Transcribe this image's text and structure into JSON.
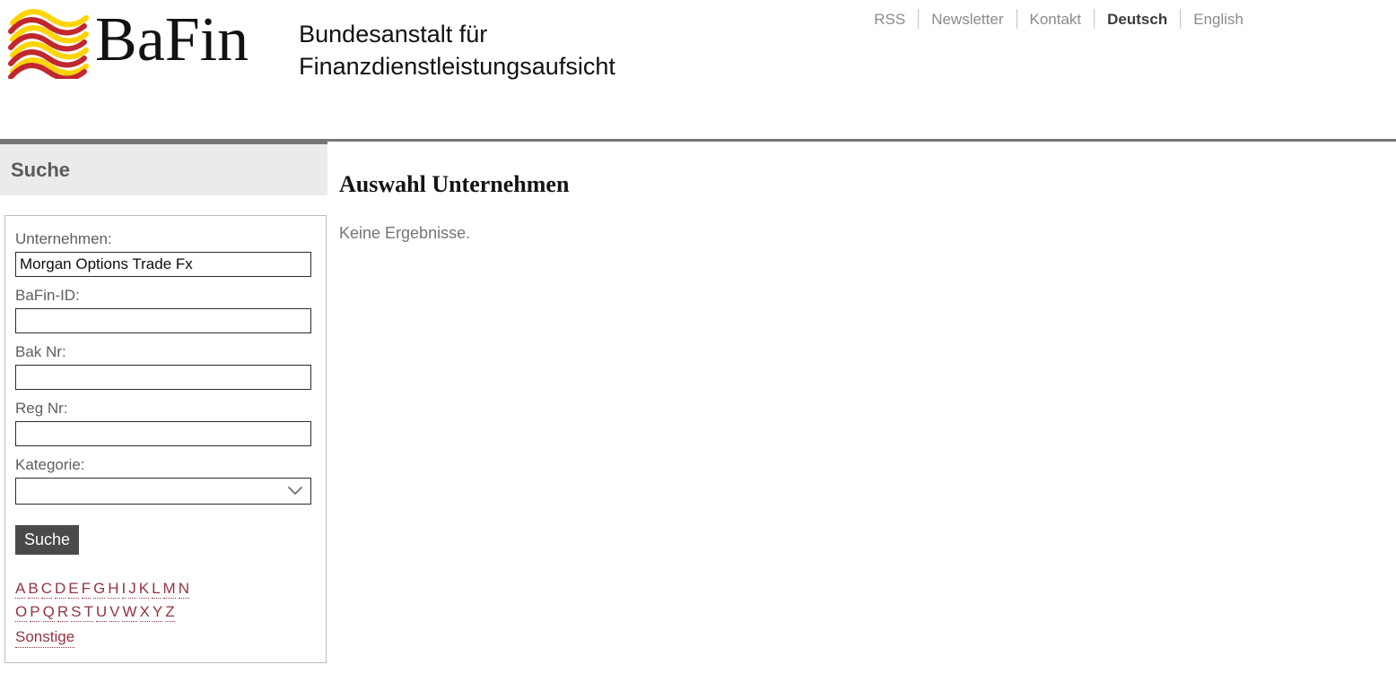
{
  "header": {
    "logo_word": "BaFin",
    "logo_subtitle": "Bundesanstalt für\nFinanzdienstleistungsaufsicht",
    "logo_icon": "bafin-waves-logo",
    "colors": {
      "wave_yellow": "#FFD400",
      "wave_red": "#C1272D",
      "rule": "#767676"
    }
  },
  "topnav": {
    "items": [
      {
        "label": "RSS",
        "active": false
      },
      {
        "label": "Newsletter",
        "active": false
      },
      {
        "label": "Kontakt",
        "active": false
      },
      {
        "label": "Deutsch",
        "active": true
      },
      {
        "label": "English",
        "active": false
      }
    ]
  },
  "sidebar": {
    "heading": "Suche",
    "fields": [
      {
        "label": "Unternehmen:",
        "value": "Morgan Options Trade Fx",
        "placeholder": "",
        "type": "text",
        "name": "unternehmen"
      },
      {
        "label": "BaFin-ID:",
        "value": "",
        "placeholder": "",
        "type": "text",
        "name": "bafin-id"
      },
      {
        "label": "Bak Nr:",
        "value": "",
        "placeholder": "",
        "type": "text",
        "name": "bak-nr"
      },
      {
        "label": "Reg Nr:",
        "value": "",
        "placeholder": "",
        "type": "text",
        "name": "reg-nr"
      },
      {
        "label": "Kategorie:",
        "value": "",
        "placeholder": "",
        "type": "select",
        "name": "kategorie"
      }
    ],
    "submit_label": "Suche",
    "alphabet_row1": [
      "A",
      "B",
      "C",
      "D",
      "E",
      "F",
      "G",
      "H",
      "I",
      "J",
      "K",
      "L",
      "M",
      "N"
    ],
    "alphabet_row2": [
      "O",
      "P",
      "Q",
      "R",
      "S",
      "T",
      "U",
      "V",
      "W",
      "X",
      "Y",
      "Z"
    ],
    "other_label": "Sonstige",
    "link_color": "#93353f"
  },
  "main": {
    "title": "Auswahl Unternehmen",
    "empty_message": "Keine Ergebnisse."
  }
}
